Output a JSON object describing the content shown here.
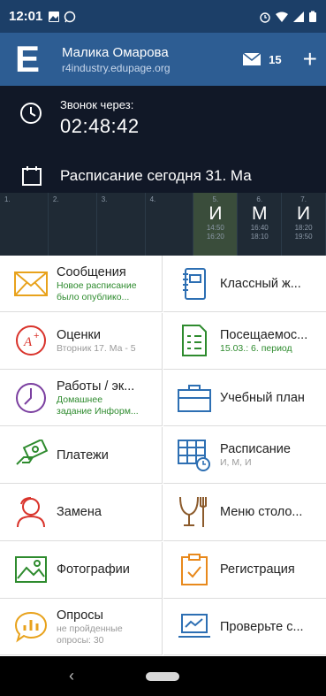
{
  "status_bar": {
    "time": "12:01",
    "left_icons": [
      "image-icon",
      "whatsapp-icon"
    ],
    "right_icons": [
      "alarm-icon",
      "wifi-icon",
      "signal-icon",
      "battery-icon"
    ]
  },
  "app_bar": {
    "user_name": "Малика Омарова",
    "school": "r4industry.edupage.org",
    "message_count": "15"
  },
  "bell": {
    "label": "Звонок через:",
    "countdown": "02:48:42"
  },
  "schedule": {
    "title": "Расписание сегодня 31. Ма",
    "slots": [
      {
        "num": "1.",
        "letter": "",
        "start": "",
        "end": "",
        "active": false
      },
      {
        "num": "2.",
        "letter": "",
        "start": "",
        "end": "",
        "active": false
      },
      {
        "num": "3.",
        "letter": "",
        "start": "",
        "end": "",
        "active": false
      },
      {
        "num": "4.",
        "letter": "",
        "start": "",
        "end": "",
        "active": false
      },
      {
        "num": "5.",
        "letter": "И",
        "start": "14:50",
        "end": "16:20",
        "active": true
      },
      {
        "num": "6.",
        "letter": "М",
        "start": "16:40",
        "end": "18:10",
        "active": false
      },
      {
        "num": "7.",
        "letter": "И",
        "start": "18:20",
        "end": "19:50",
        "active": false
      }
    ]
  },
  "tiles": [
    {
      "name": "messages",
      "title": "Сообщения",
      "sub1": "Новое расписание",
      "sub2": "было опублико...",
      "sub_color": "green",
      "icon": "envelope-icon",
      "col": "left"
    },
    {
      "name": "class-book",
      "title": "Классный ж...",
      "sub1": "",
      "sub2": "",
      "sub_color": "",
      "icon": "notebook-icon",
      "col": "right"
    },
    {
      "name": "grades",
      "title": "Оценки",
      "sub1": "Вторник 17. Ма - 5",
      "sub2": "",
      "sub_color": "grey",
      "icon": "grade-icon",
      "col": "left"
    },
    {
      "name": "attendance",
      "title": "Посещаемос...",
      "sub1": "15.03.: 6. период",
      "sub2": "",
      "sub_color": "green",
      "icon": "attendance-icon",
      "col": "right"
    },
    {
      "name": "homework",
      "title": "Работы / эк...",
      "sub1": "Домашнее",
      "sub2": "задание Информ...",
      "sub_color": "green",
      "icon": "clock-outline-icon",
      "col": "left"
    },
    {
      "name": "curriculum",
      "title": "Учебный план",
      "sub1": "",
      "sub2": "",
      "sub_color": "",
      "icon": "briefcase-icon",
      "col": "right"
    },
    {
      "name": "payments",
      "title": "Платежи",
      "sub1": "",
      "sub2": "",
      "sub_color": "",
      "icon": "money-hand-icon",
      "col": "left"
    },
    {
      "name": "timetable",
      "title": "Расписание",
      "sub1": "И, М, И",
      "sub2": "",
      "sub_color": "grey",
      "icon": "timetable-icon",
      "col": "right"
    },
    {
      "name": "substitution",
      "title": "Замена",
      "sub1": "",
      "sub2": "",
      "sub_color": "",
      "icon": "person-swap-icon",
      "col": "left"
    },
    {
      "name": "canteen",
      "title": "Меню столо...",
      "sub1": "",
      "sub2": "",
      "sub_color": "",
      "icon": "cutlery-icon",
      "col": "right"
    },
    {
      "name": "photos",
      "title": "Фотографии",
      "sub1": "",
      "sub2": "",
      "sub_color": "",
      "icon": "photo-icon",
      "col": "left"
    },
    {
      "name": "registration",
      "title": "Регистрация",
      "sub1": "",
      "sub2": "",
      "sub_color": "",
      "icon": "clipboard-check-icon",
      "col": "right"
    },
    {
      "name": "polls",
      "title": "Опросы",
      "sub1": "не пройденные",
      "sub2": "опросы: 30",
      "sub_color": "grey",
      "icon": "poll-bubble-icon",
      "col": "left"
    },
    {
      "name": "check",
      "title": "Проверьте с...",
      "sub1": "",
      "sub2": "",
      "sub_color": "",
      "icon": "laptop-chart-icon",
      "col": "right"
    }
  ],
  "colors": {
    "status_bar": "#1c3f68",
    "app_bar": "#2d5d93",
    "dark_panel": "#111827",
    "timeline": "#1f2a35",
    "active_slot": "#3a4d3b",
    "green_text": "#2e8b2e"
  }
}
